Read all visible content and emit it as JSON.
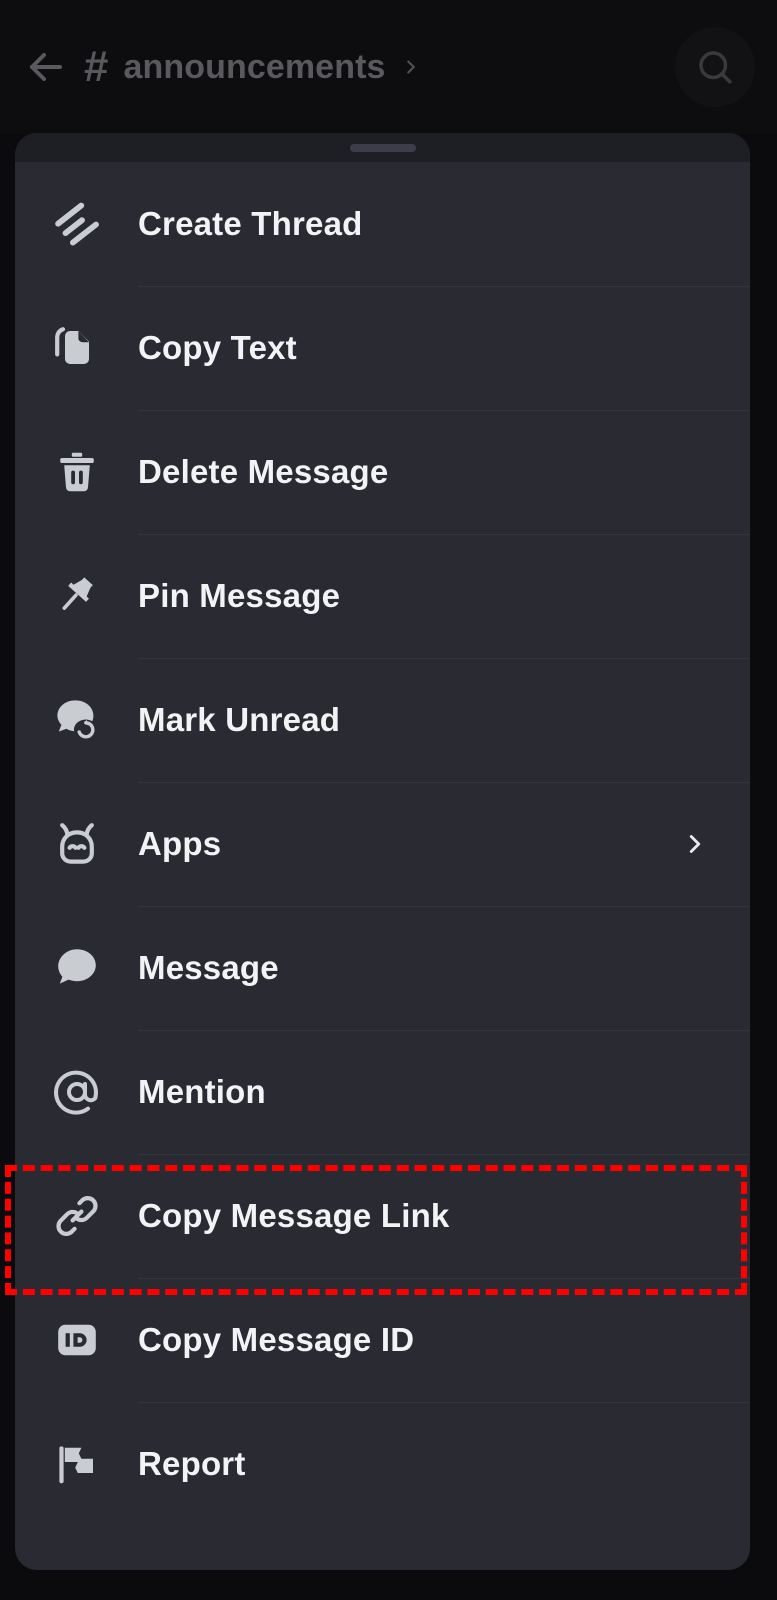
{
  "header": {
    "back_icon": "back-arrow-icon",
    "channel_prefix": "#",
    "channel_name": "announcements",
    "chevron_icon": "chevron-right-icon",
    "search_icon": "search-icon"
  },
  "sheet": {
    "handle": "drag-handle",
    "menu_items": [
      {
        "id": "create-thread",
        "label": "Create Thread",
        "icon": "thread-icon",
        "trailing": ""
      },
      {
        "id": "copy-text",
        "label": "Copy Text",
        "icon": "copy-icon",
        "trailing": ""
      },
      {
        "id": "delete-message",
        "label": "Delete Message",
        "icon": "trash-icon",
        "trailing": ""
      },
      {
        "id": "pin-message",
        "label": "Pin Message",
        "icon": "pin-icon",
        "trailing": ""
      },
      {
        "id": "mark-unread",
        "label": "Mark Unread",
        "icon": "mark-unread-icon",
        "trailing": ""
      },
      {
        "id": "apps",
        "label": "Apps",
        "icon": "bot-face-icon",
        "trailing": "chevron-right-icon"
      },
      {
        "id": "message",
        "label": "Message",
        "icon": "speech-bubble-icon",
        "trailing": ""
      },
      {
        "id": "mention",
        "label": "Mention",
        "icon": "at-sign-icon",
        "trailing": ""
      },
      {
        "id": "copy-message-link",
        "label": "Copy Message Link",
        "icon": "link-icon",
        "trailing": ""
      },
      {
        "id": "copy-message-id",
        "label": "Copy Message ID",
        "icon": "id-badge-icon",
        "trailing": ""
      },
      {
        "id": "report",
        "label": "Report",
        "icon": "flag-icon",
        "trailing": ""
      }
    ]
  },
  "highlight": {
    "target_label": "Copy Message Link",
    "color": "#ff0000",
    "style": "dashed"
  },
  "colors": {
    "sheet_background": "#2a2a33",
    "screen_background": "#0b0b0e",
    "appbar_background": "#0d0d10",
    "divider": "#35353f",
    "label_text": "#f2f3f5",
    "icon_fill": "#c9ccd1",
    "dimmed_text": "#59595e"
  }
}
